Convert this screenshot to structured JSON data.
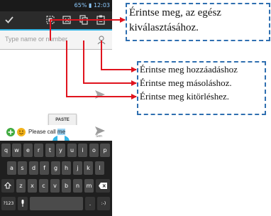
{
  "status_bar": {
    "text": "65% ▮ 12:03"
  },
  "search": {
    "placeholder": "Type name or number"
  },
  "paste_button": {
    "label": "PASTE"
  },
  "send_label": "Sen",
  "message": {
    "prefix": "Please call ",
    "selected": "me"
  },
  "keyboard": {
    "row1": [
      "q",
      "w",
      "e",
      "r",
      "t",
      "y",
      "u",
      "i",
      "o",
      "p"
    ],
    "row2": [
      "a",
      "s",
      "d",
      "f",
      "g",
      "h",
      "j",
      "k",
      "l"
    ],
    "row3": [
      "z",
      "x",
      "c",
      "v",
      "b",
      "n",
      "m"
    ],
    "mode_key": "?123",
    "dot_key": ".",
    "enter_key": ":-)"
  },
  "callouts": {
    "select_all": {
      "line1": "Érintse meg, az egész",
      "line2": "kiválasztásához."
    },
    "add": "Érintse meg hozzáadáshoz",
    "copy": "Érintse meg másoláshoz.",
    "cut": "Érintse meg kitörléshez."
  },
  "colors": {
    "arrow": "#e0141e",
    "callout_border": "#2f6fb0",
    "accent": "#33b5e5"
  }
}
